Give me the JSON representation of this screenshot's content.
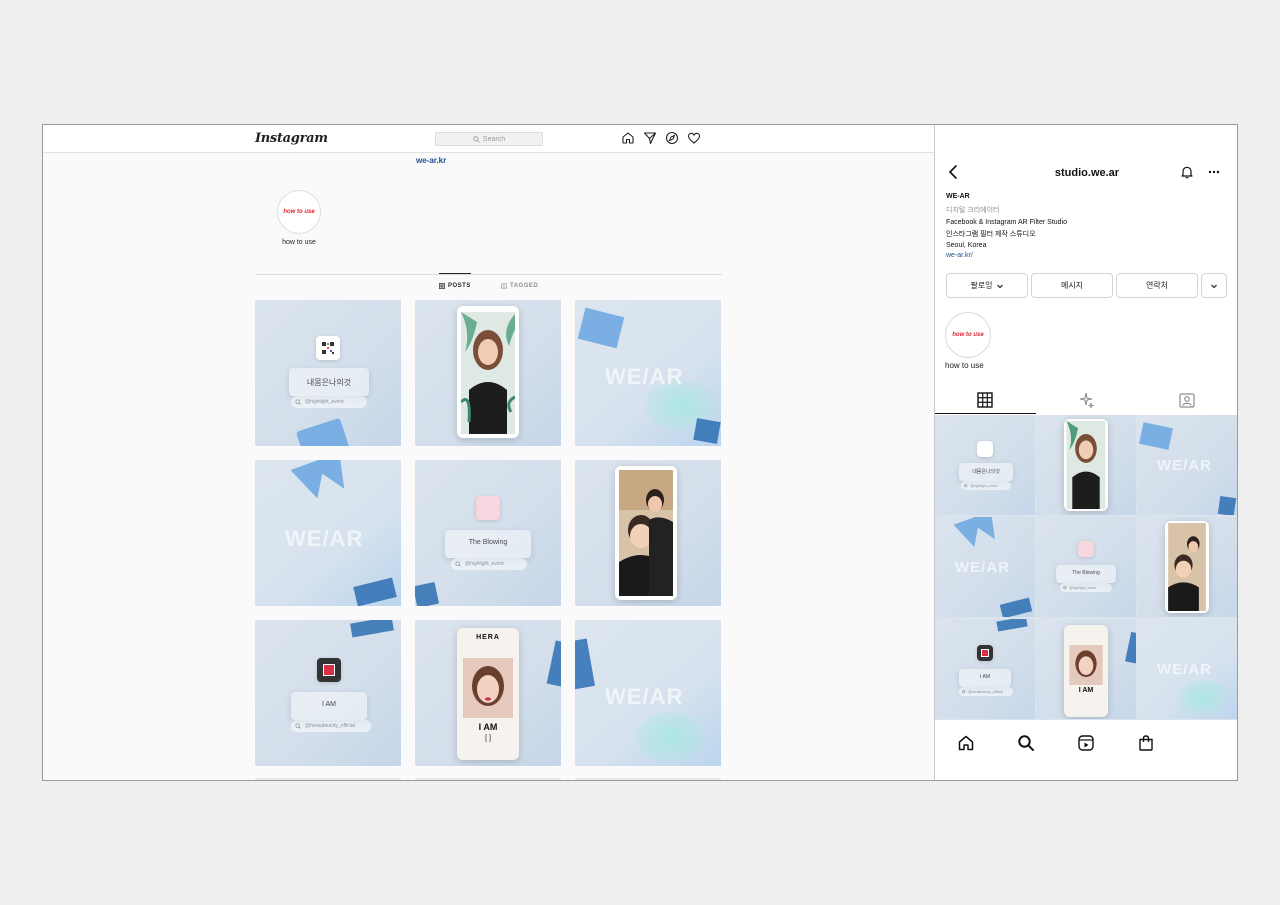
{
  "desktop": {
    "logo": "Instagram",
    "search_placeholder": "Search",
    "website_link": "we-ar.kr",
    "highlight": {
      "cover_text": "how to use",
      "label": "how to use"
    },
    "tabs": [
      {
        "label": "POSTS",
        "icon": "grid-icon",
        "active": true
      },
      {
        "label": "TAGGED",
        "icon": "tagged-icon",
        "active": false
      }
    ],
    "posts": [
      {
        "type": "filter-card",
        "title": "내몸은나의것",
        "handle": "@highlight_event"
      },
      {
        "type": "photo",
        "subject": "woman-portrait"
      },
      {
        "type": "logo",
        "text": "WE/AR"
      },
      {
        "type": "logo",
        "text": "WE/AR"
      },
      {
        "type": "filter-card",
        "title": "The Blowing",
        "handle": "@highlight_event"
      },
      {
        "type": "photo",
        "subject": "two-men-selfie"
      },
      {
        "type": "filter-card",
        "title": "I AM",
        "handle": "@heraabeauty_official"
      },
      {
        "type": "poster",
        "brand": "HERA",
        "headline": "I AM",
        "bracket": "[ ]"
      },
      {
        "type": "logo",
        "text": "WE/AR"
      }
    ]
  },
  "mobile": {
    "username": "studio.we.ar",
    "display_name": "WE-AR",
    "category": "디지털 크리에이터",
    "bio_lines": [
      "Facebook & Instagram AR Filter Studio",
      "인스타그램 필터 제작 스튜디오",
      "Seoul, Korea"
    ],
    "link": "we-ar.kr/",
    "buttons": {
      "following": "팔로잉",
      "message": "메시지",
      "contact": "연락처"
    },
    "highlight": {
      "cover_text": "how to use",
      "label": "how to use"
    },
    "grid_titles": {
      "tile1": "내몸은나의것",
      "tile1_handle": "@highlight_event",
      "tile5": "The Blowing",
      "tile5_handle": "@highlight_event",
      "tile7": "I AM",
      "tile7_handle": "@heraabeauty_official",
      "tile8": "I AM",
      "logo": "WE/AR"
    }
  },
  "colors": {
    "accent_link": "#1d4f91",
    "highlight_red": "#e0222b",
    "tile_bg": "#d6e1ec",
    "shape_blue": "#6aa6e0"
  }
}
